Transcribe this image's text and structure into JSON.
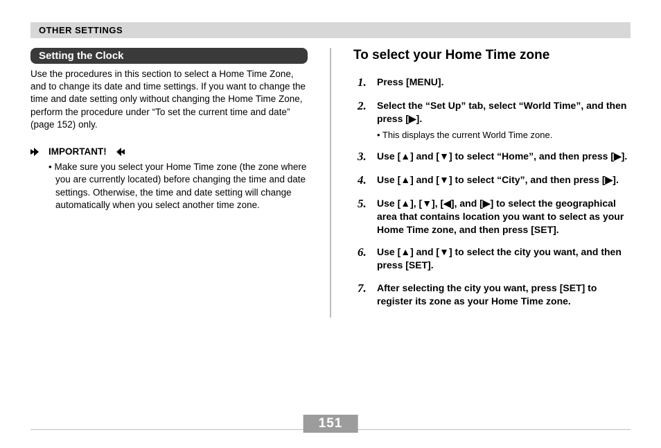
{
  "header": "OTHER SETTINGS",
  "left": {
    "section_title": "Setting the Clock",
    "intro": "Use the procedures in this section to select a Home Time Zone, and to change its date and time settings. If you want to change the time and date setting only without changing the Home Time Zone, perform the procedure under “To set the current time and date” (page 152) only.",
    "important_label": "IMPORTANT!",
    "important_bullet": "• Make sure you select your Home Time zone (the zone where you are currently located) before changing the time and date settings. Otherwise, the time and date setting will change automatically when you select another time zone."
  },
  "right": {
    "heading": "To select your Home Time zone",
    "steps": [
      {
        "n": "1.",
        "text": "Press [MENU].",
        "sub": ""
      },
      {
        "n": "2.",
        "text": "Select the “Set Up” tab, select “World Time”, and then press [▶].",
        "sub": "•  This displays the current World Time zone."
      },
      {
        "n": "3.",
        "text": "Use [▲] and [▼] to select “Home”, and then press [▶].",
        "sub": ""
      },
      {
        "n": "4.",
        "text": "Use [▲] and [▼] to select “City”, and then press [▶].",
        "sub": ""
      },
      {
        "n": "5.",
        "text": "Use [▲], [▼], [◀], and [▶] to select the geographical area that contains location you want to select as your Home Time zone, and then press [SET].",
        "sub": ""
      },
      {
        "n": "6.",
        "text": "Use [▲] and [▼] to select the city you want, and then press [SET].",
        "sub": ""
      },
      {
        "n": "7.",
        "text": "After selecting the city you want, press [SET] to register its zone as your Home Time zone.",
        "sub": ""
      }
    ]
  },
  "page_number": "151"
}
